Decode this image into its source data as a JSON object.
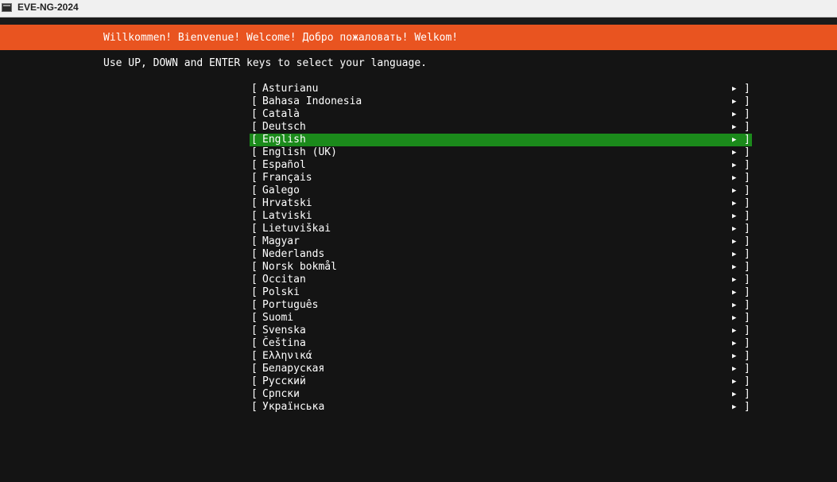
{
  "window": {
    "title": "EVE-NG-2024"
  },
  "banner": {
    "text": "Willkommen! Bienvenue! Welcome! Добро пожаловать! Welkom!"
  },
  "instructions": "Use UP, DOWN and ENTER keys to select your language.",
  "bracket_open": "[",
  "bracket_close": "]",
  "arrow_glyph": "▶",
  "colors": {
    "accent": "#e95420",
    "selection": "#1b8a1b",
    "background": "#141414"
  },
  "languages": [
    {
      "label": "Asturianu"
    },
    {
      "label": "Bahasa Indonesia"
    },
    {
      "label": "Català"
    },
    {
      "label": "Deutsch"
    },
    {
      "label": "English",
      "selected": true
    },
    {
      "label": "English (UK)"
    },
    {
      "label": "Español"
    },
    {
      "label": "Français"
    },
    {
      "label": "Galego"
    },
    {
      "label": "Hrvatski"
    },
    {
      "label": "Latviski"
    },
    {
      "label": "Lietuviškai"
    },
    {
      "label": "Magyar"
    },
    {
      "label": "Nederlands"
    },
    {
      "label": "Norsk bokmål"
    },
    {
      "label": "Occitan"
    },
    {
      "label": "Polski"
    },
    {
      "label": "Português"
    },
    {
      "label": "Suomi"
    },
    {
      "label": "Svenska"
    },
    {
      "label": "Čeština"
    },
    {
      "label": "Ελληνικά"
    },
    {
      "label": "Беларуская"
    },
    {
      "label": "Русский"
    },
    {
      "label": "Српски"
    },
    {
      "label": "Українська"
    }
  ]
}
